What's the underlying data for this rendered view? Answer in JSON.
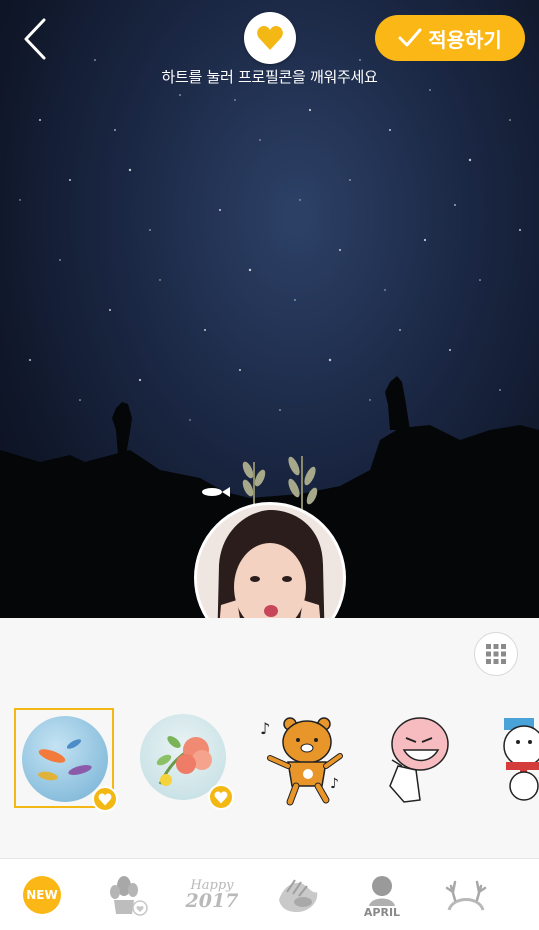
{
  "header": {
    "back_icon": "chevron-left-icon",
    "heart_icon": "heart-icon",
    "hint_text": "하트를 눌러 프로필콘을 깨워주세요",
    "apply_label": "적용하기",
    "apply_icon": "checkmark-icon"
  },
  "colors": {
    "accent": "#fbb715",
    "sky": "#1b2845",
    "sheet_bg": "#f7f7f7"
  },
  "sticker_panel": {
    "grid_icon": "grid-icon",
    "stickers": [
      {
        "name": "fish-bubble-sticker",
        "selected": true,
        "heart": true
      },
      {
        "name": "flower-sticker",
        "selected": false,
        "heart": true
      },
      {
        "name": "ryan-bear-sticker",
        "selected": false,
        "heart": false
      },
      {
        "name": "apeach-sticker",
        "selected": false,
        "heart": false
      },
      {
        "name": "snowman-sticker",
        "selected": false,
        "heart": false
      }
    ]
  },
  "tabs": {
    "new_label": "NEW",
    "happy_line1": "Happy",
    "happy_line2": "2017",
    "april_label": "APRIL",
    "items": [
      "new-tab",
      "cactus-tab",
      "happy-2017-tab",
      "hands-tab",
      "april-tab",
      "antlers-tab"
    ]
  }
}
